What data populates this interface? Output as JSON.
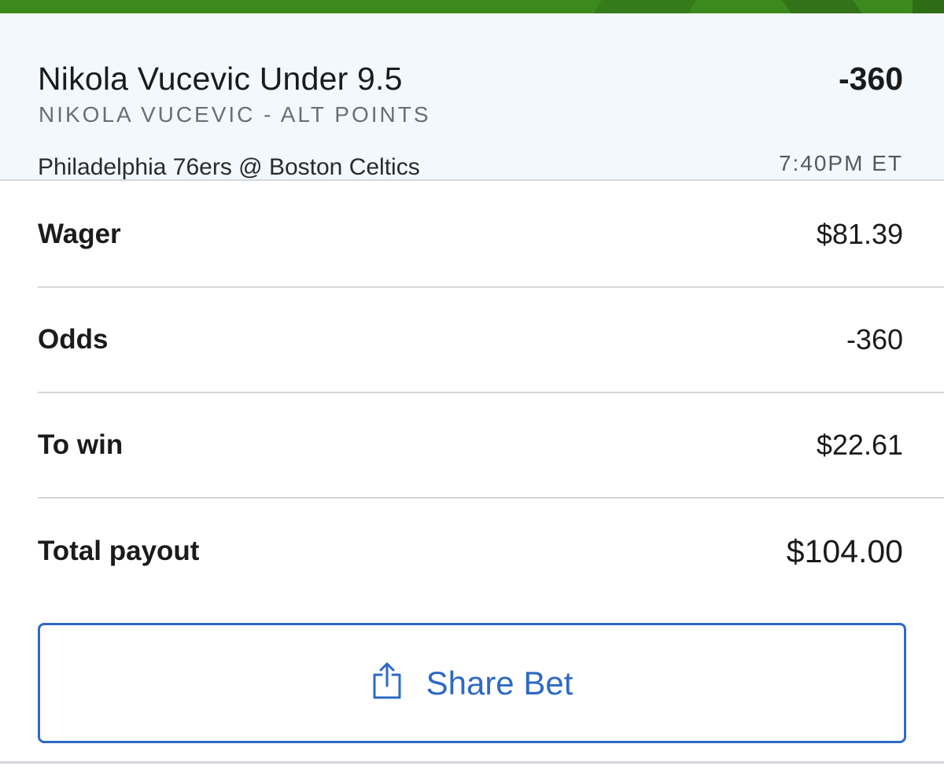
{
  "bet": {
    "selection": "Nikola Vucevic Under 9.5",
    "odds": "-360",
    "market": "NIKOLA VUCEVIC - ALT POINTS",
    "matchup": "Philadelphia 76ers @ Boston Celtics",
    "time": "7:40PM ET"
  },
  "details": [
    {
      "label": "Wager",
      "value": "$81.39"
    },
    {
      "label": "Odds",
      "value": "-360"
    },
    {
      "label": "To win",
      "value": "$22.61"
    },
    {
      "label": "Total payout",
      "value": "$104.00"
    }
  ],
  "share": {
    "label": "Share Bet",
    "icon": "share-icon"
  },
  "colors": {
    "brand_green": "#3c8a1e",
    "header_bg": "#f3f8fd",
    "accent_blue": "#2e69c5",
    "divider": "#d4d7dc"
  }
}
